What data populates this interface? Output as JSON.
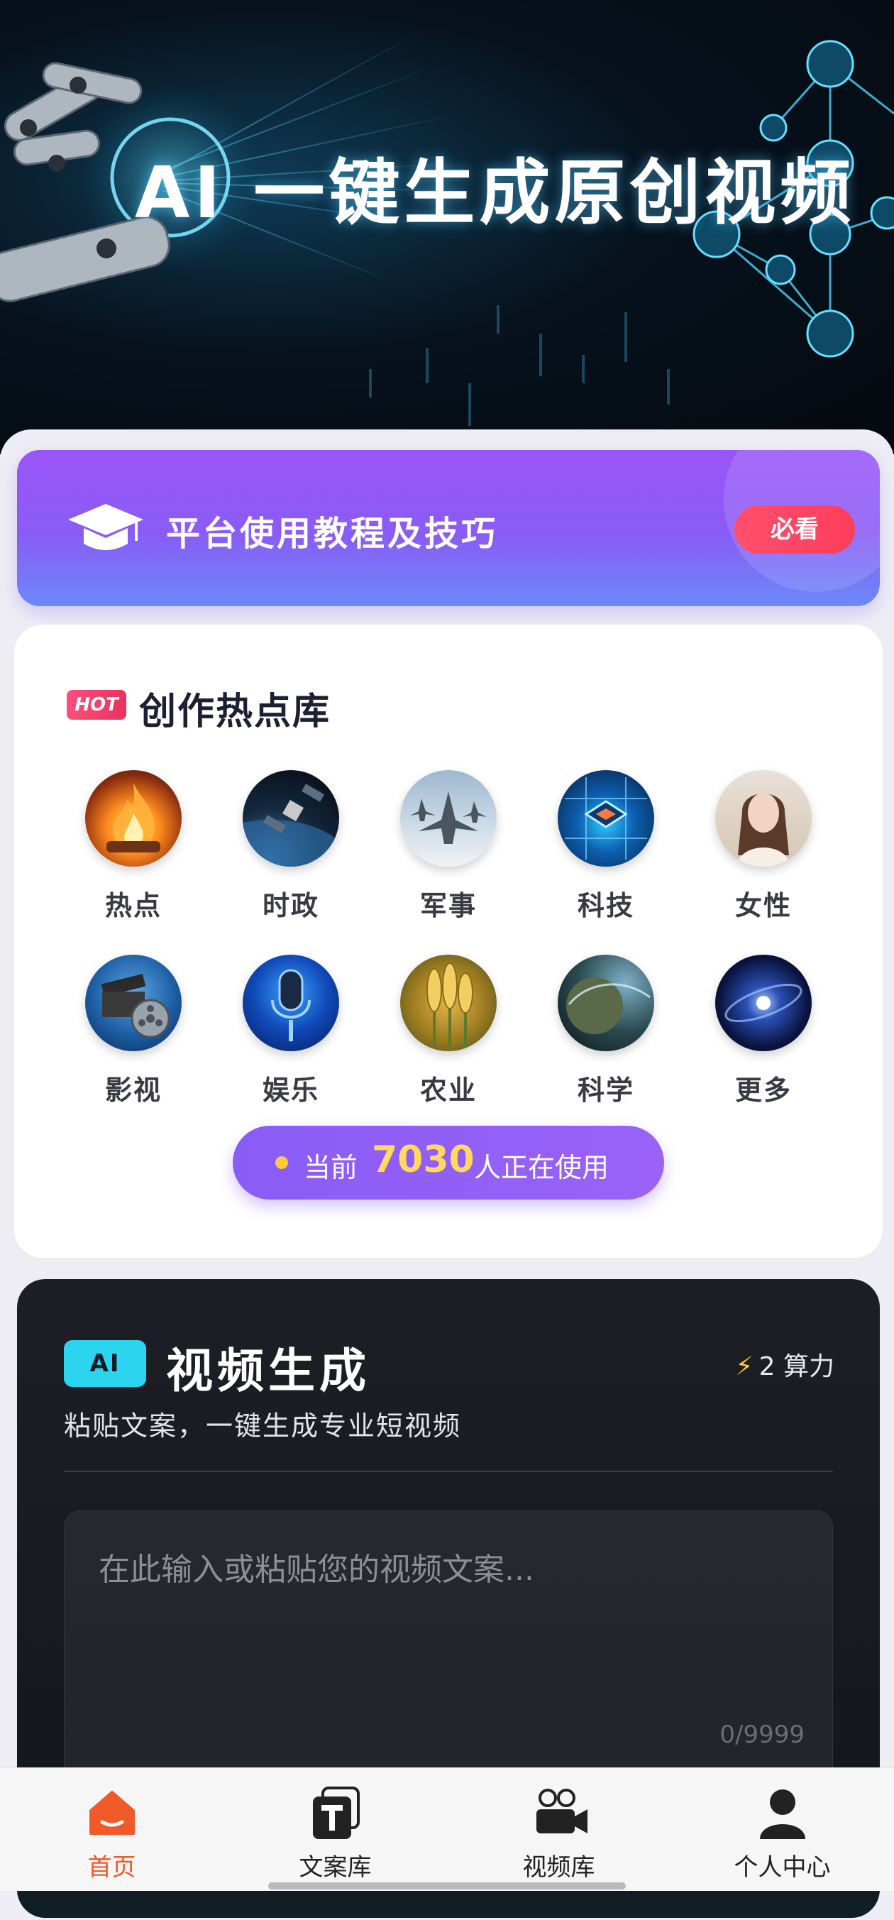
{
  "hero": {
    "title": "AI 一键生成原创视频"
  },
  "tutorial": {
    "label": "平台使用教程及技巧",
    "badge": "必看"
  },
  "hot": {
    "badge": "HOT",
    "title": "创作热点库",
    "categories": [
      {
        "label": "热点",
        "icon": "fire-icon"
      },
      {
        "label": "时政",
        "icon": "satellite-icon"
      },
      {
        "label": "军事",
        "icon": "fighter-jet-icon"
      },
      {
        "label": "科技",
        "icon": "chip-icon"
      },
      {
        "label": "女性",
        "icon": "woman-portrait-icon"
      },
      {
        "label": "影视",
        "icon": "film-reel-icon"
      },
      {
        "label": "娱乐",
        "icon": "microphone-icon"
      },
      {
        "label": "农业",
        "icon": "wheat-icon"
      },
      {
        "label": "科学",
        "icon": "planet-icon"
      },
      {
        "label": "更多",
        "icon": "galaxy-icon"
      }
    ],
    "users": {
      "prefix": "当前",
      "count": "7030",
      "suffix": "人正在使用"
    }
  },
  "ai_video": {
    "badge": "AI",
    "title": "视频生成",
    "cost": "2 算力",
    "subtitle": "粘贴文案，一键生成专业短视频",
    "input_placeholder": "在此输入或粘贴您的视频文案...",
    "input_value": "",
    "counter": "0/9999"
  },
  "nav": [
    {
      "label": "首页",
      "icon": "home-icon",
      "active": true
    },
    {
      "label": "文案库",
      "icon": "text-document-icon",
      "active": false
    },
    {
      "label": "视频库",
      "icon": "video-camera-icon",
      "active": false
    },
    {
      "label": "个人中心",
      "icon": "user-icon",
      "active": false
    }
  ],
  "colors": {
    "accent": "#8a5cf6",
    "hot": "#e8325e",
    "ai": "#2bd4ef",
    "nav_active": "#f05a28",
    "gold": "#ffd860"
  }
}
